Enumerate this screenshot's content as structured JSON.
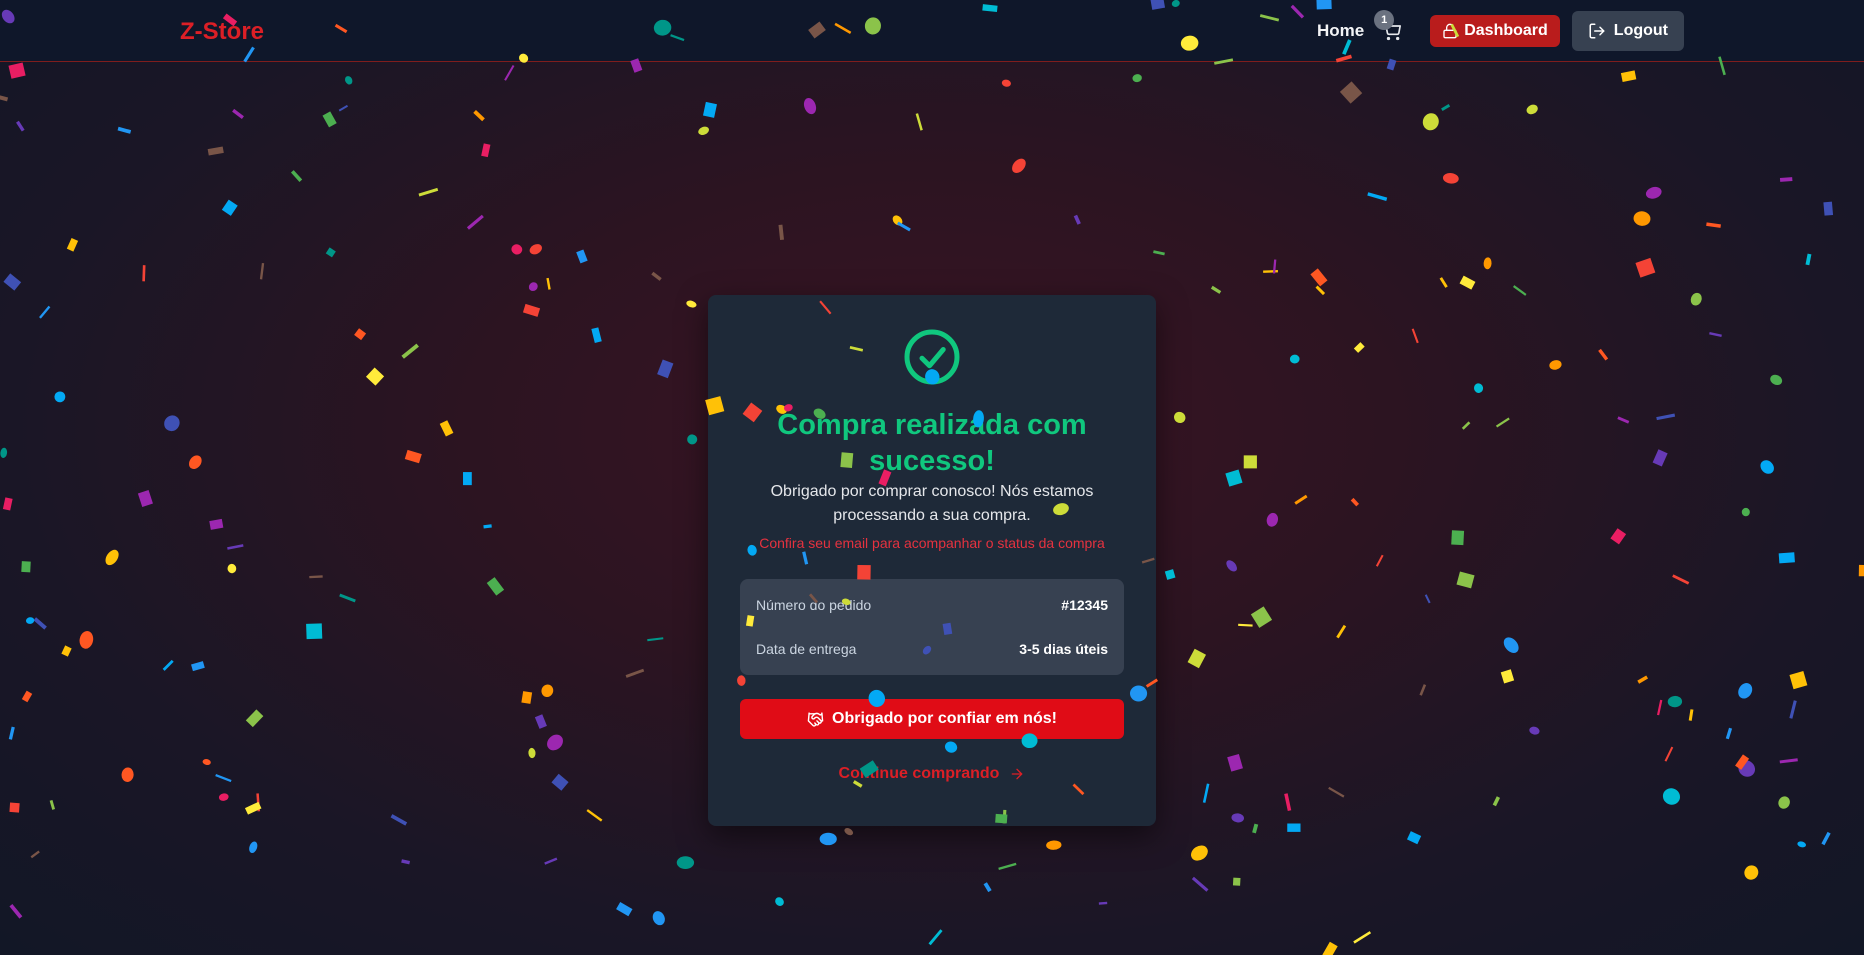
{
  "navbar": {
    "brand": "Z-Store",
    "home_label": "Home",
    "cart_count": "1",
    "dashboard_label": "Dashboard",
    "logout_label": "Logout"
  },
  "card": {
    "title": "Compra realizada com sucesso!",
    "description": "Obrigado por comprar conosco! Nós estamos processando a sua compra.",
    "email_notice": "Confira seu email para acompanhar o status da compra",
    "order_number_label": "Número do pedido",
    "order_number_value": "#12345",
    "delivery_label": "Data de entrega",
    "delivery_value": "3-5 dias úteis",
    "thanks_button_label": "Obrigado por confiar em nós!",
    "continue_link_label": "Continue comprando"
  },
  "icons": {
    "success": "circle-check-icon",
    "cart": "shopping-cart-icon",
    "dashboard": "lock-icon",
    "logout": "log-out-icon",
    "thanks": "handshake-icon",
    "continue": "arrow-right-icon"
  },
  "colors": {
    "brand": "#dc1f26",
    "success": "#10c77e",
    "primary_button": "#e00c16",
    "dashboard_button": "#b91c1c",
    "logout_button": "#374151",
    "card_background": "#1e2938",
    "navbar_background": "#0f172a"
  },
  "confetti_colors": [
    "#f44336",
    "#e91e63",
    "#9c27b0",
    "#673ab7",
    "#3f51b5",
    "#2196f3",
    "#03a9f4",
    "#00bcd4",
    "#009688",
    "#4caf50",
    "#8bc34a",
    "#cddc39",
    "#ffeb3b",
    "#ffc107",
    "#ff9800",
    "#ff5722",
    "#795548"
  ]
}
